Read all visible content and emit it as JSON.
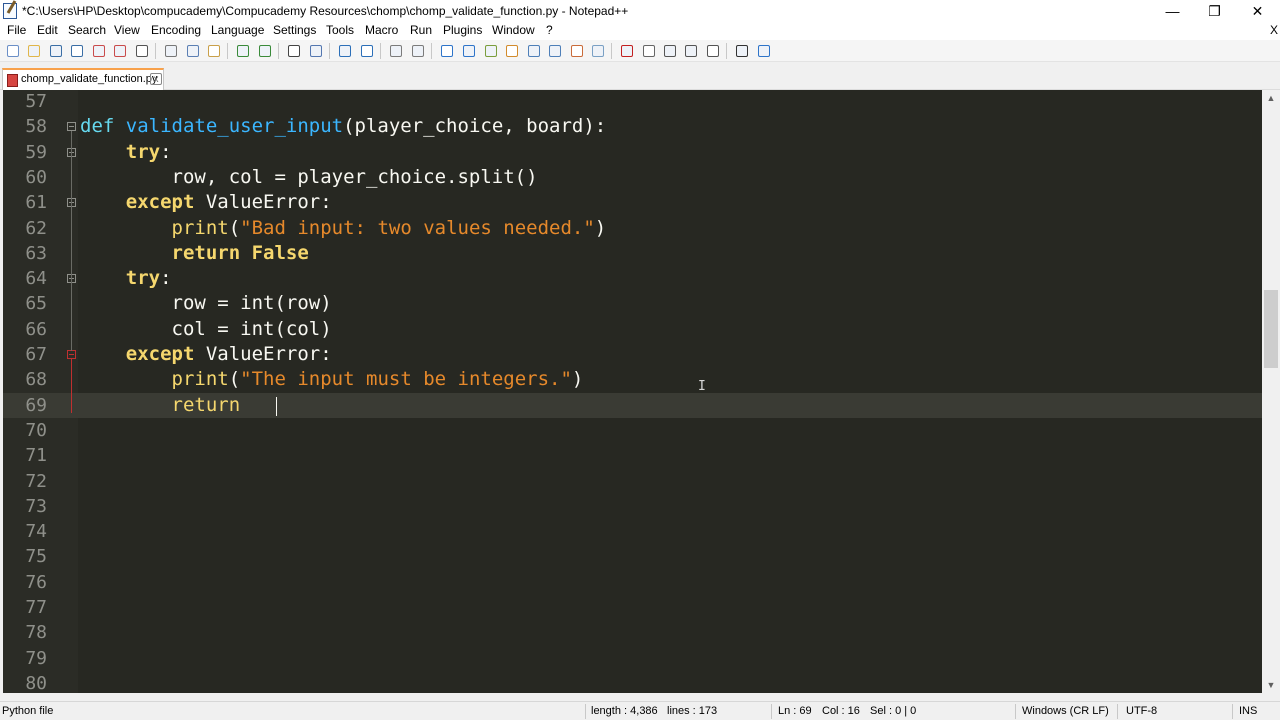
{
  "window": {
    "title": "*C:\\Users\\HP\\Desktop\\compucademy\\Compucademy Resources\\chomp\\chomp_validate_function.py - Notepad++",
    "minimize": "—",
    "restore": "❐",
    "close": "✕"
  },
  "menu": {
    "items": [
      "File",
      "Edit",
      "Search",
      "View",
      "Encoding",
      "Language",
      "Settings",
      "Tools",
      "Macro",
      "Run",
      "Plugins",
      "Window",
      "?"
    ],
    "close_doc": "X"
  },
  "toolbar": {
    "icons": [
      "new-file-icon",
      "open-file-icon",
      "save-icon",
      "save-all-icon",
      "close-icon",
      "close-all-icon",
      "print-icon",
      "cut-icon",
      "copy-icon",
      "paste-icon",
      "undo-icon",
      "redo-icon",
      "find-icon",
      "replace-icon",
      "zoom-in-icon",
      "zoom-out-icon",
      "sync-vertical-icon",
      "sync-horizontal-icon",
      "word-wrap-icon",
      "show-all-chars-icon",
      "indent-guide-icon",
      "udl-icon",
      "doc-map-icon",
      "function-list-icon",
      "folder-workspace-icon",
      "monitoring-icon",
      "record-macro-icon",
      "stop-macro-icon",
      "play-macro-icon",
      "run-macro-multiple-icon",
      "save-macro-icon",
      "spell-check-icon",
      "spell-options-icon"
    ]
  },
  "tab": {
    "label": "chomp_validate_function.py",
    "close": "x"
  },
  "editor": {
    "lines": [
      {
        "n": "57",
        "tokens": []
      },
      {
        "n": "58",
        "tokens": [
          [
            "kw",
            "def "
          ],
          [
            "fn",
            "validate_user_input"
          ],
          [
            "pl",
            "(player_choice, board):"
          ]
        ]
      },
      {
        "n": "59",
        "tokens": [
          [
            "pl",
            "    "
          ],
          [
            "kwb",
            "try"
          ],
          [
            "pl",
            ":"
          ]
        ]
      },
      {
        "n": "60",
        "tokens": [
          [
            "pl",
            "        row, col = player_choice.split()"
          ]
        ]
      },
      {
        "n": "61",
        "tokens": [
          [
            "pl",
            "    "
          ],
          [
            "kwb",
            "except"
          ],
          [
            "pl",
            " ValueError:"
          ]
        ]
      },
      {
        "n": "62",
        "tokens": [
          [
            "pl",
            "        "
          ],
          [
            "bi",
            "print"
          ],
          [
            "pl",
            "("
          ],
          [
            "str",
            "\"Bad input: two values needed.\""
          ],
          [
            "pl",
            ")"
          ]
        ]
      },
      {
        "n": "63",
        "tokens": [
          [
            "pl",
            "        "
          ],
          [
            "kwb",
            "return False"
          ]
        ]
      },
      {
        "n": "64",
        "tokens": [
          [
            "pl",
            "    "
          ],
          [
            "kwb",
            "try"
          ],
          [
            "pl",
            ":"
          ]
        ]
      },
      {
        "n": "65",
        "tokens": [
          [
            "pl",
            "        row = int(row)"
          ]
        ]
      },
      {
        "n": "66",
        "tokens": [
          [
            "pl",
            "        col = int(col)"
          ]
        ]
      },
      {
        "n": "67",
        "tokens": [
          [
            "pl",
            "    "
          ],
          [
            "kwb",
            "except"
          ],
          [
            "pl",
            " ValueError:"
          ]
        ]
      },
      {
        "n": "68",
        "tokens": [
          [
            "pl",
            "        "
          ],
          [
            "bi",
            "print"
          ],
          [
            "pl",
            "("
          ],
          [
            "str",
            "\"The input must be integers.\""
          ],
          [
            "pl",
            ")"
          ]
        ]
      },
      {
        "n": "69",
        "tokens": [
          [
            "pl",
            "        "
          ],
          [
            "bi",
            "return"
          ],
          [
            "pl",
            " "
          ]
        ]
      },
      {
        "n": "70",
        "tokens": []
      },
      {
        "n": "71",
        "tokens": []
      },
      {
        "n": "72",
        "tokens": []
      },
      {
        "n": "73",
        "tokens": []
      },
      {
        "n": "74",
        "tokens": []
      },
      {
        "n": "75",
        "tokens": []
      },
      {
        "n": "76",
        "tokens": []
      },
      {
        "n": "77",
        "tokens": []
      },
      {
        "n": "78",
        "tokens": []
      },
      {
        "n": "79",
        "tokens": []
      },
      {
        "n": "80",
        "tokens": []
      }
    ],
    "current_line": "69",
    "colors": {
      "background": "#272822",
      "keyword": "#66d9ef",
      "function": "#3bb6ff",
      "string": "#e6892b",
      "builtin": "#f5d76e",
      "text": "#f8f8f2"
    }
  },
  "statusbar": {
    "language": "Python file",
    "length": "length : 4,386",
    "lines": "lines : 173",
    "ln": "Ln : 69",
    "col": "Col : 16",
    "sel": "Sel : 0 | 0",
    "eol": "Windows (CR LF)",
    "encoding": "UTF-8",
    "mode": "INS"
  }
}
